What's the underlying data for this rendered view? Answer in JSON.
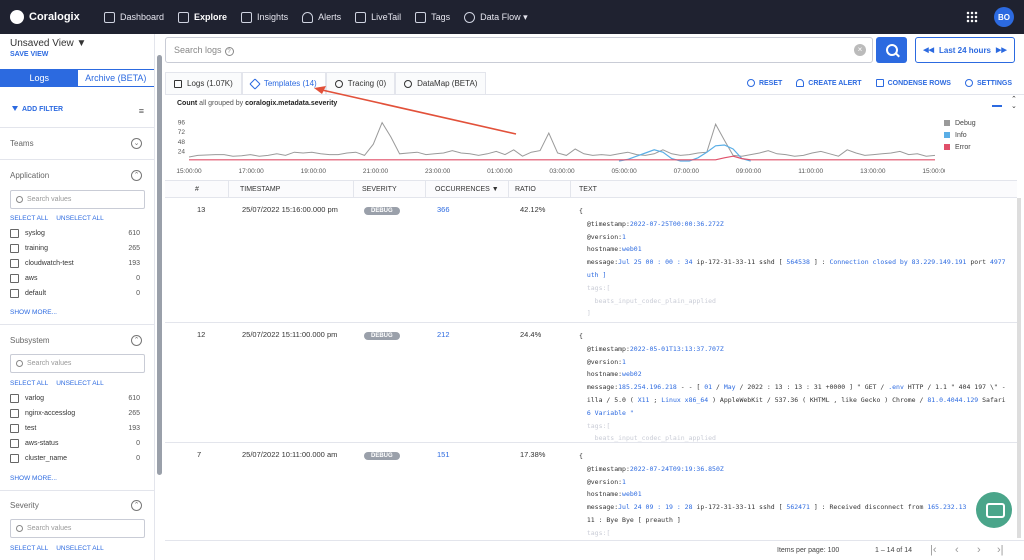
{
  "nav": {
    "brand": "Coralogix",
    "items": [
      {
        "label": "Dashboard",
        "icon": "dashboard-icon"
      },
      {
        "label": "Explore",
        "icon": "explore-icon",
        "active": true
      },
      {
        "label": "Insights",
        "icon": "insights-icon"
      },
      {
        "label": "Alerts",
        "icon": "bell-icon"
      },
      {
        "label": "LiveTail",
        "icon": "play-icon"
      },
      {
        "label": "Tags",
        "icon": "tag-icon"
      },
      {
        "label": "Data Flow ▾",
        "icon": "data-flow-icon"
      }
    ],
    "avatar": "BO"
  },
  "sidebar": {
    "view_title": "Unsaved View ▼",
    "save_view": "SAVE VIEW",
    "mode_logs": "Logs",
    "mode_archive": "Archive (BETA)",
    "add_filter": "ADD FILTER",
    "teams": "Teams",
    "select_all": "SELECT ALL",
    "unselect_all": "UNSELECT ALL",
    "show_more": "SHOW MORE...",
    "search_placeholder": "Search values",
    "application": {
      "title": "Application",
      "items": [
        {
          "label": "syslog",
          "count": "610"
        },
        {
          "label": "training",
          "count": "265"
        },
        {
          "label": "cloudwatch-test",
          "count": "193"
        },
        {
          "label": "aws",
          "count": "0"
        },
        {
          "label": "default",
          "count": "0"
        }
      ]
    },
    "subsystem": {
      "title": "Subsystem",
      "items": [
        {
          "label": "varlog",
          "count": "610"
        },
        {
          "label": "nginx-accesslog",
          "count": "265"
        },
        {
          "label": "test",
          "count": "193"
        },
        {
          "label": "aws-status",
          "count": "0"
        },
        {
          "label": "cluster_name",
          "count": "0"
        }
      ]
    },
    "severity": {
      "title": "Severity"
    }
  },
  "search": {
    "placeholder": "Search logs",
    "time_range": "Last 24 hours"
  },
  "tabs": [
    {
      "label": "Logs (1.07K)"
    },
    {
      "label": "Templates (14)",
      "active": true
    },
    {
      "label": "Tracing (0)"
    },
    {
      "label": "DataMap (BETA)"
    }
  ],
  "actions": [
    "RESET",
    "CREATE ALERT",
    "CONDENSE ROWS",
    "SETTINGS"
  ],
  "count_label": {
    "prefix": "Count",
    "middle": "all grouped by",
    "field": "coralogix.metadata.severity"
  },
  "chart_data": {
    "type": "line",
    "x_ticks": [
      "15:00:00",
      "17:00:00",
      "19:00:00",
      "21:00:00",
      "23:00:00",
      "01:00:00",
      "03:00:00",
      "05:00:00",
      "07:00:00",
      "09:00:00",
      "11:00:00",
      "13:00:00",
      "15:00:00"
    ],
    "y_ticks": [
      24,
      48,
      72,
      96
    ],
    "ylim": [
      0,
      110
    ],
    "series": [
      {
        "name": "Debug",
        "color": "#9a9a9a",
        "values": [
          10,
          14,
          15,
          16,
          16,
          12,
          13,
          16,
          12,
          14,
          18,
          14,
          22,
          20,
          22,
          18,
          16,
          16,
          20,
          22,
          14,
          42,
          96,
          60,
          18,
          20,
          22,
          16,
          18,
          20,
          26,
          20,
          18,
          14,
          18,
          24,
          16,
          28,
          12,
          22,
          26,
          70,
          20,
          14,
          30,
          18,
          14,
          16,
          14,
          18,
          22,
          16,
          14,
          18,
          28,
          18,
          14,
          16,
          20,
          22,
          92,
          52,
          14,
          12,
          16,
          20,
          26,
          18,
          16,
          12,
          14,
          20,
          24,
          18,
          12,
          28,
          20,
          14,
          16,
          18,
          20,
          24,
          16,
          18,
          12,
          14
        ]
      },
      {
        "name": "Info",
        "color": "#5aaee6",
        "values": [
          0,
          0,
          0,
          0,
          0,
          0,
          0,
          0,
          0,
          0,
          0,
          0,
          0,
          0,
          0,
          0,
          0,
          0,
          0,
          0,
          0,
          0,
          0,
          0,
          0,
          0,
          0,
          0,
          0,
          0,
          0,
          0,
          0,
          0,
          0,
          0,
          0,
          0,
          0,
          0,
          0,
          0,
          0,
          0,
          0,
          0,
          0,
          0,
          0,
          0,
          4,
          12,
          20,
          28,
          22,
          6,
          0,
          0,
          8,
          22,
          38,
          40,
          30,
          6,
          0,
          0,
          0,
          0,
          0,
          0,
          0,
          0,
          0,
          0,
          0,
          0,
          0,
          0,
          0,
          0,
          0,
          0,
          0,
          0,
          0,
          0
        ]
      },
      {
        "name": "Error",
        "color": "#e0506a",
        "values": [
          3,
          3,
          3,
          3,
          3,
          3,
          3,
          3,
          3,
          3,
          3,
          3,
          3,
          3,
          3,
          3,
          3,
          3,
          3,
          3,
          3,
          3,
          3,
          3,
          3,
          3,
          3,
          3,
          3,
          3,
          3,
          3,
          3,
          3,
          3,
          3,
          3,
          3,
          3,
          3,
          3,
          3,
          3,
          3,
          3,
          3,
          3,
          3,
          3,
          3,
          3,
          3,
          3,
          3,
          3,
          3,
          3,
          3,
          3,
          3,
          3,
          8,
          12,
          6,
          3,
          3,
          3,
          3,
          3,
          3,
          3,
          3,
          3,
          3,
          3,
          3,
          3,
          3,
          3,
          3,
          3,
          3,
          3,
          3,
          3,
          3
        ]
      }
    ]
  },
  "table": {
    "headers": {
      "num": "#",
      "timestamp": "TIMESTAMP",
      "severity": "SEVERITY",
      "occurrences": "OCCURRENCES ▼",
      "ratio": "RATIO",
      "text": "TEXT"
    },
    "rows": [
      {
        "num": "13",
        "timestamp": "25/07/2022 15:16:00.000 pm",
        "severity": "DEBUG",
        "occurrences": "366",
        "ratio": "42.12%",
        "lines": [
          [
            {
              "t": "{"
            }
          ],
          [
            {
              "t": "  @timestamp:"
            },
            {
              "t": "2022-07-25T00:00:36.272Z",
              "v": 1
            }
          ],
          [
            {
              "t": "  @version:"
            },
            {
              "t": "1",
              "v": 1
            }
          ],
          [
            {
              "t": "  hostname:"
            },
            {
              "t": "web01",
              "v": 1
            }
          ],
          [
            {
              "t": "  message:"
            },
            {
              "t": "Jul 25 00 : 00 : 34",
              "v": 1
            },
            {
              "t": " ip-172-31-33-11 sshd [ "
            },
            {
              "t": "564538",
              "v": 1
            },
            {
              "t": " ] : "
            },
            {
              "t": "Connection closed by 83.229.149.191",
              "v": 1
            },
            {
              "t": " port "
            },
            {
              "t": "4977",
              "v": 1
            }
          ],
          [
            {
              "t": "  "
            },
            {
              "t": "uth ]",
              "v": 1
            }
          ],
          [
            {
              "t": "  tags:[",
              "f": 1
            }
          ],
          [
            {
              "t": "    beats_input_codec_plain_applied",
              "f": 1
            }
          ],
          [
            {
              "t": "  ]",
              "f": 1
            }
          ]
        ]
      },
      {
        "num": "12",
        "timestamp": "25/07/2022 15:11:00.000 pm",
        "severity": "DEBUG",
        "occurrences": "212",
        "ratio": "24.4%",
        "lines": [
          [
            {
              "t": "{"
            }
          ],
          [
            {
              "t": "  @timestamp:"
            },
            {
              "t": "2022-05-01T13:13:37.707Z",
              "v": 1
            }
          ],
          [
            {
              "t": "  @version:"
            },
            {
              "t": "1",
              "v": 1
            }
          ],
          [
            {
              "t": "  hostname:"
            },
            {
              "t": "web02",
              "v": 1
            }
          ],
          [
            {
              "t": "  message:"
            },
            {
              "t": "185.254.196.218",
              "v": 1
            },
            {
              "t": " - - [ "
            },
            {
              "t": "01",
              "v": 1
            },
            {
              "t": " / "
            },
            {
              "t": "May",
              "v": 1
            },
            {
              "t": " / 2022 : 13 : 13 : 31 +0000 ] \" GET / "
            },
            {
              "t": ".env",
              "v": 1
            },
            {
              "t": " HTTP / 1.1 \" 404 197 \\\" -"
            }
          ],
          [
            {
              "t": "  illa / 5.0 ( "
            },
            {
              "t": "X11",
              "v": 1
            },
            {
              "t": " ; "
            },
            {
              "t": "Linux x86_64",
              "v": 1
            },
            {
              "t": " ) AppleWebKit / 537.36 ( KHTML , like Gecko ) Chrome / "
            },
            {
              "t": "81.0.4044.129",
              "v": 1
            },
            {
              "t": " Safari"
            }
          ],
          [
            {
              "t": "  "
            },
            {
              "t": "6 Variable \"",
              "v": 1
            }
          ],
          [
            {
              "t": "  tags:[",
              "f": 1
            }
          ],
          [
            {
              "t": "    beats_input_codec_plain_applied",
              "f": 1
            }
          ]
        ]
      },
      {
        "num": "7",
        "timestamp": "25/07/2022 10:11:00.000 am",
        "severity": "DEBUG",
        "occurrences": "151",
        "ratio": "17.38%",
        "lines": [
          [
            {
              "t": "{"
            }
          ],
          [
            {
              "t": "  @timestamp:"
            },
            {
              "t": "2022-07-24T09:19:36.850Z",
              "v": 1
            }
          ],
          [
            {
              "t": "  @version:"
            },
            {
              "t": "1",
              "v": 1
            }
          ],
          [
            {
              "t": "  hostname:"
            },
            {
              "t": "web01",
              "v": 1
            }
          ],
          [
            {
              "t": "  message:"
            },
            {
              "t": "Jul 24 09 : 19 : 28",
              "v": 1
            },
            {
              "t": " ip-172-31-33-11 sshd [ "
            },
            {
              "t": "562471",
              "v": 1
            },
            {
              "t": " ] : Received disconnect from "
            },
            {
              "t": "165.232.13",
              "v": 1
            }
          ],
          [
            {
              "t": "  11 : Bye Bye [ preauth ]"
            }
          ],
          [
            {
              "t": "  tags:[",
              "f": 1
            }
          ]
        ]
      }
    ]
  },
  "footer": {
    "items_per_page": "Items per page: 100",
    "range": "1 – 14 of 14"
  }
}
